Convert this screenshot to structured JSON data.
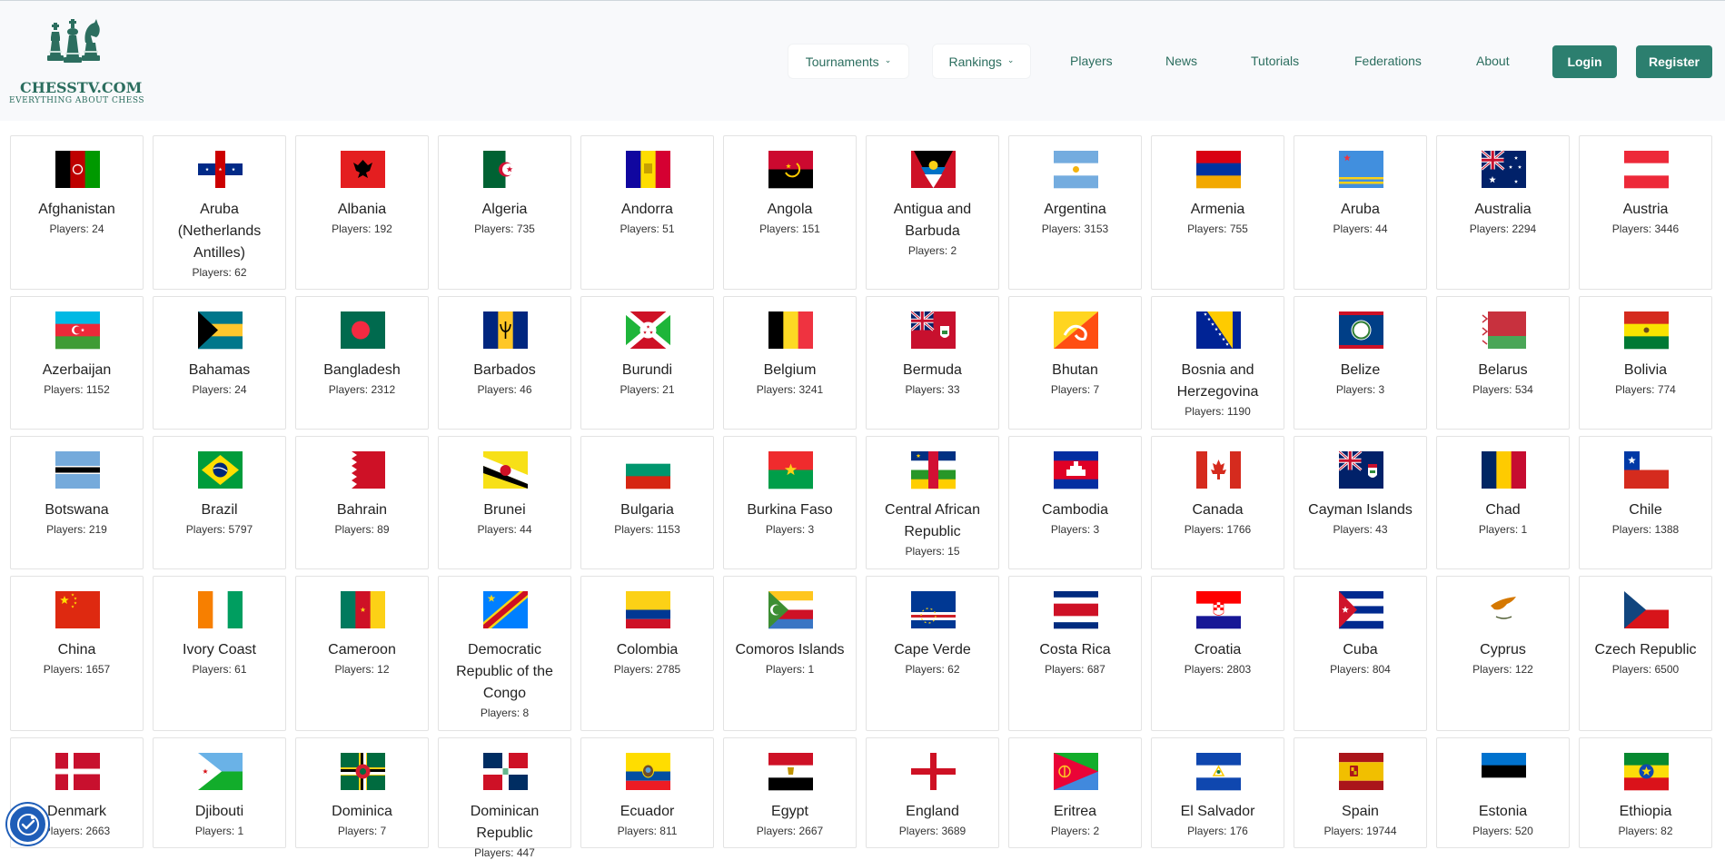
{
  "site": {
    "title": "CHESSTV.COM",
    "tagline": "EVERYTHING ABOUT CHESS"
  },
  "nav": {
    "tournaments": "Tournaments",
    "rankings": "Rankings",
    "players": "Players",
    "news": "News",
    "tutorials": "Tutorials",
    "federations": "Federations",
    "about": "About",
    "login": "Login",
    "register": "Register"
  },
  "countries": [
    {
      "name": "Afghanistan",
      "count": "Players: 24"
    },
    {
      "name": "Aruba (Netherlands Antilles)",
      "count": "Players: 62"
    },
    {
      "name": "Albania",
      "count": "Players: 192"
    },
    {
      "name": "Algeria",
      "count": "Players: 735"
    },
    {
      "name": "Andorra",
      "count": "Players: 51"
    },
    {
      "name": "Angola",
      "count": "Players: 151"
    },
    {
      "name": "Antigua and Barbuda",
      "count": "Players: 2"
    },
    {
      "name": "Argentina",
      "count": "Players: 3153"
    },
    {
      "name": "Armenia",
      "count": "Players: 755"
    },
    {
      "name": "Aruba",
      "count": "Players: 44"
    },
    {
      "name": "Australia",
      "count": "Players: 2294"
    },
    {
      "name": "Austria",
      "count": "Players: 3446"
    },
    {
      "name": "Azerbaijan",
      "count": "Players: 1152"
    },
    {
      "name": "Bahamas",
      "count": "Players: 24"
    },
    {
      "name": "Bangladesh",
      "count": "Players: 2312"
    },
    {
      "name": "Barbados",
      "count": "Players: 46"
    },
    {
      "name": "Burundi",
      "count": "Players: 21"
    },
    {
      "name": "Belgium",
      "count": "Players: 3241"
    },
    {
      "name": "Bermuda",
      "count": "Players: 33"
    },
    {
      "name": "Bhutan",
      "count": "Players: 7"
    },
    {
      "name": "Bosnia and Herzegovina",
      "count": "Players: 1190"
    },
    {
      "name": "Belize",
      "count": "Players: 3"
    },
    {
      "name": "Belarus",
      "count": "Players: 534"
    },
    {
      "name": "Bolivia",
      "count": "Players: 774"
    },
    {
      "name": "Botswana",
      "count": "Players: 219"
    },
    {
      "name": "Brazil",
      "count": "Players: 5797"
    },
    {
      "name": "Bahrain",
      "count": "Players: 89"
    },
    {
      "name": "Brunei",
      "count": "Players: 44"
    },
    {
      "name": "Bulgaria",
      "count": "Players: 1153"
    },
    {
      "name": "Burkina Faso",
      "count": "Players: 3"
    },
    {
      "name": "Central African Republic",
      "count": "Players: 15"
    },
    {
      "name": "Cambodia",
      "count": "Players: 3"
    },
    {
      "name": "Canada",
      "count": "Players: 1766"
    },
    {
      "name": "Cayman Islands",
      "count": "Players: 43"
    },
    {
      "name": "Chad",
      "count": "Players: 1"
    },
    {
      "name": "Chile",
      "count": "Players: 1388"
    },
    {
      "name": "China",
      "count": "Players: 1657"
    },
    {
      "name": "Ivory Coast",
      "count": "Players: 61"
    },
    {
      "name": "Cameroon",
      "count": "Players: 12"
    },
    {
      "name": "Democratic Republic of the Congo",
      "count": "Players: 8"
    },
    {
      "name": "Colombia",
      "count": "Players: 2785"
    },
    {
      "name": "Comoros Islands",
      "count": "Players: 1"
    },
    {
      "name": "Cape Verde",
      "count": "Players: 62"
    },
    {
      "name": "Costa Rica",
      "count": "Players: 687"
    },
    {
      "name": "Croatia",
      "count": "Players: 2803"
    },
    {
      "name": "Cuba",
      "count": "Players: 804"
    },
    {
      "name": "Cyprus",
      "count": "Players: 122"
    },
    {
      "name": "Czech Republic",
      "count": "Players: 6500"
    },
    {
      "name": "Denmark",
      "count": "Players: 2663"
    },
    {
      "name": "Djibouti",
      "count": "Players: 1"
    },
    {
      "name": "Dominica",
      "count": "Players: 7"
    },
    {
      "name": "Dominican Republic",
      "count": "Players: 447"
    },
    {
      "name": "Ecuador",
      "count": "Players: 811"
    },
    {
      "name": "Egypt",
      "count": "Players: 2667"
    },
    {
      "name": "England",
      "count": "Players: 3689"
    },
    {
      "name": "Eritrea",
      "count": "Players: 2"
    },
    {
      "name": "El Salvador",
      "count": "Players: 176"
    },
    {
      "name": "Spain",
      "count": "Players: 19744"
    },
    {
      "name": "Estonia",
      "count": "Players: 520"
    },
    {
      "name": "Ethiopia",
      "count": "Players: 82"
    }
  ],
  "flag_icons": [
    "afghanistan-flag-icon",
    "aruba-netherlands-antilles-flag-icon",
    "albania-flag-icon",
    "algeria-flag-icon",
    "andorra-flag-icon",
    "angola-flag-icon",
    "antigua-flag-icon",
    "argentina-flag-icon",
    "armenia-flag-icon",
    "aruba-flag-icon",
    "australia-flag-icon",
    "austria-flag-icon",
    "azerbaijan-flag-icon",
    "bahamas-flag-icon",
    "bangladesh-flag-icon",
    "barbados-flag-icon",
    "burundi-flag-icon",
    "belgium-flag-icon",
    "bermuda-flag-icon",
    "bhutan-flag-icon",
    "bosnia-flag-icon",
    "belize-flag-icon",
    "belarus-flag-icon",
    "bolivia-flag-icon",
    "botswana-flag-icon",
    "brazil-flag-icon",
    "bahrain-flag-icon",
    "brunei-flag-icon",
    "bulgaria-flag-icon",
    "burkina-faso-flag-icon",
    "car-flag-icon",
    "cambodia-flag-icon",
    "canada-flag-icon",
    "cayman-flag-icon",
    "chad-flag-icon",
    "chile-flag-icon",
    "china-flag-icon",
    "ivory-coast-flag-icon",
    "cameroon-flag-icon",
    "drc-flag-icon",
    "colombia-flag-icon",
    "comoros-flag-icon",
    "cape-verde-flag-icon",
    "costa-rica-flag-icon",
    "croatia-flag-icon",
    "cuba-flag-icon",
    "cyprus-flag-icon",
    "czech-flag-icon",
    "denmark-flag-icon",
    "djibouti-flag-icon",
    "dominica-flag-icon",
    "dominican-republic-flag-icon",
    "ecuador-flag-icon",
    "egypt-flag-icon",
    "england-flag-icon",
    "eritrea-flag-icon",
    "el-salvador-flag-icon",
    "spain-flag-icon",
    "estonia-flag-icon",
    "ethiopia-flag-icon"
  ],
  "colors": {
    "brand": "#2c6e5f",
    "button": "#2c7f6f",
    "header_bg": "#f8f9fb",
    "accessibility": "#1f5eb8"
  }
}
